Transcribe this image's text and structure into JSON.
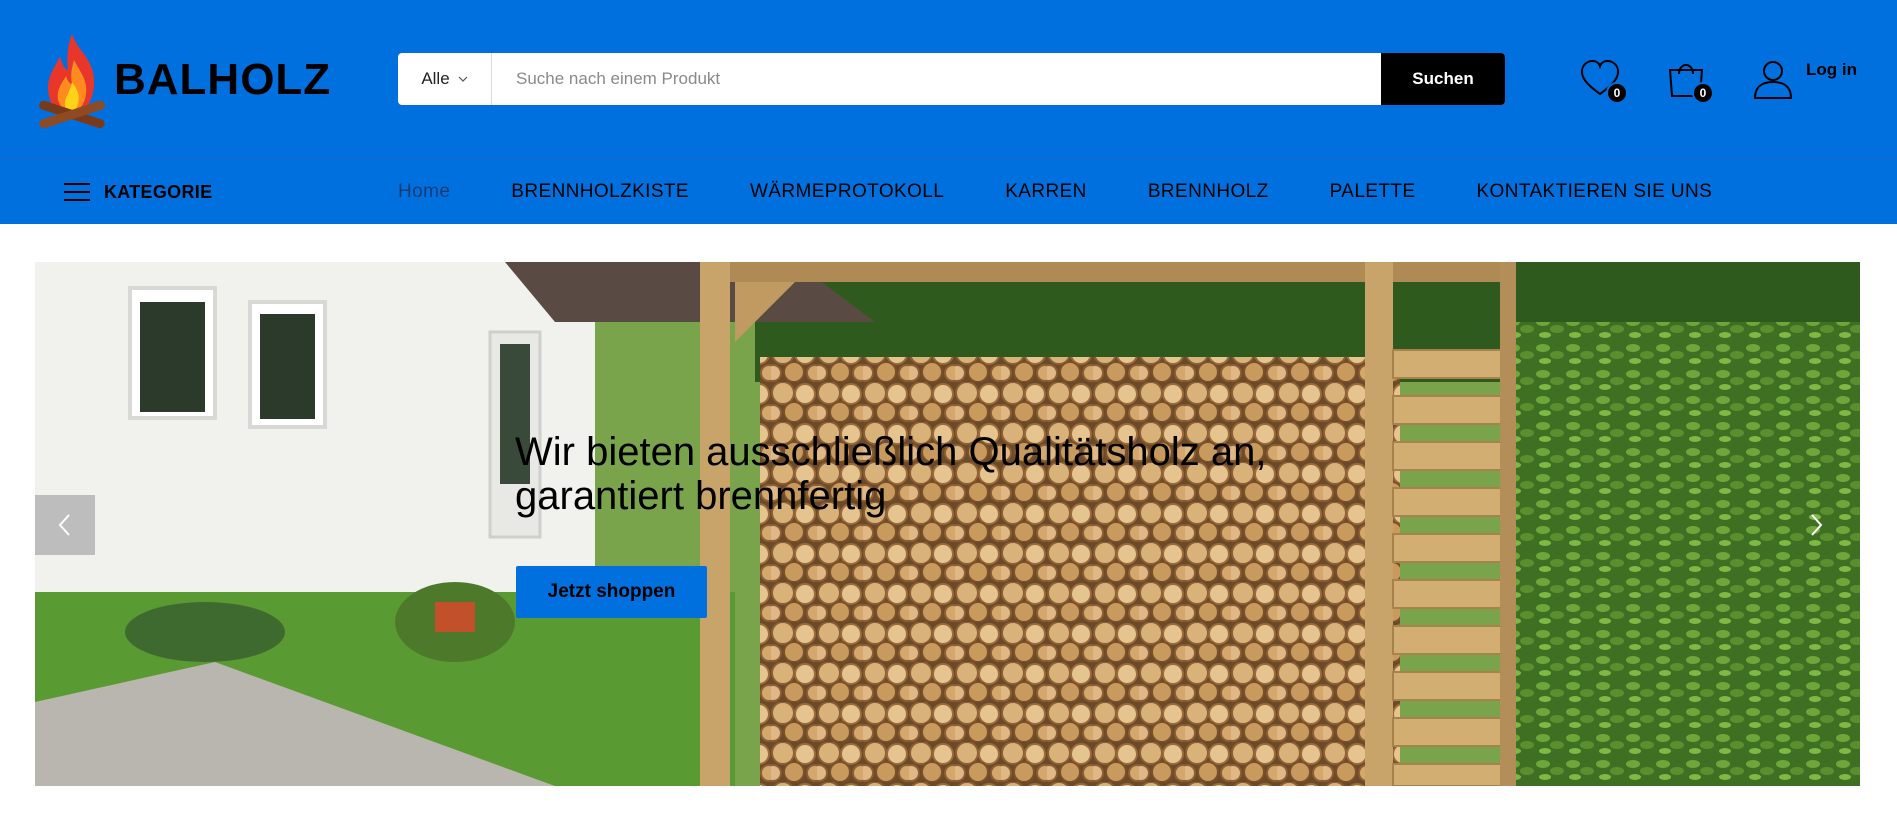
{
  "brand": {
    "name": "BALHOLZ"
  },
  "search": {
    "category": "Alle",
    "placeholder": "Suche nach einem Produkt",
    "button_label": "Suchen"
  },
  "header": {
    "wishlist_count": "0",
    "cart_count": "0",
    "login_label": "Log in"
  },
  "nav": {
    "category_label": "KATEGORIE",
    "items": [
      {
        "label": "Home"
      },
      {
        "label": "BRENNHOLZKISTE"
      },
      {
        "label": "WÄRMEPROTOKOLL"
      },
      {
        "label": "KARREN"
      },
      {
        "label": "BRENNHOLZ"
      },
      {
        "label": "PALETTE"
      },
      {
        "label": "KONTAKTIEREN SIE UNS"
      }
    ]
  },
  "hero": {
    "title": "Wir bieten ausschließlich Qualitätsholz an, garantiert brennfertig",
    "cta_label": "Jetzt shoppen"
  },
  "colors": {
    "primary": "#0070df",
    "dark": "#000000"
  }
}
